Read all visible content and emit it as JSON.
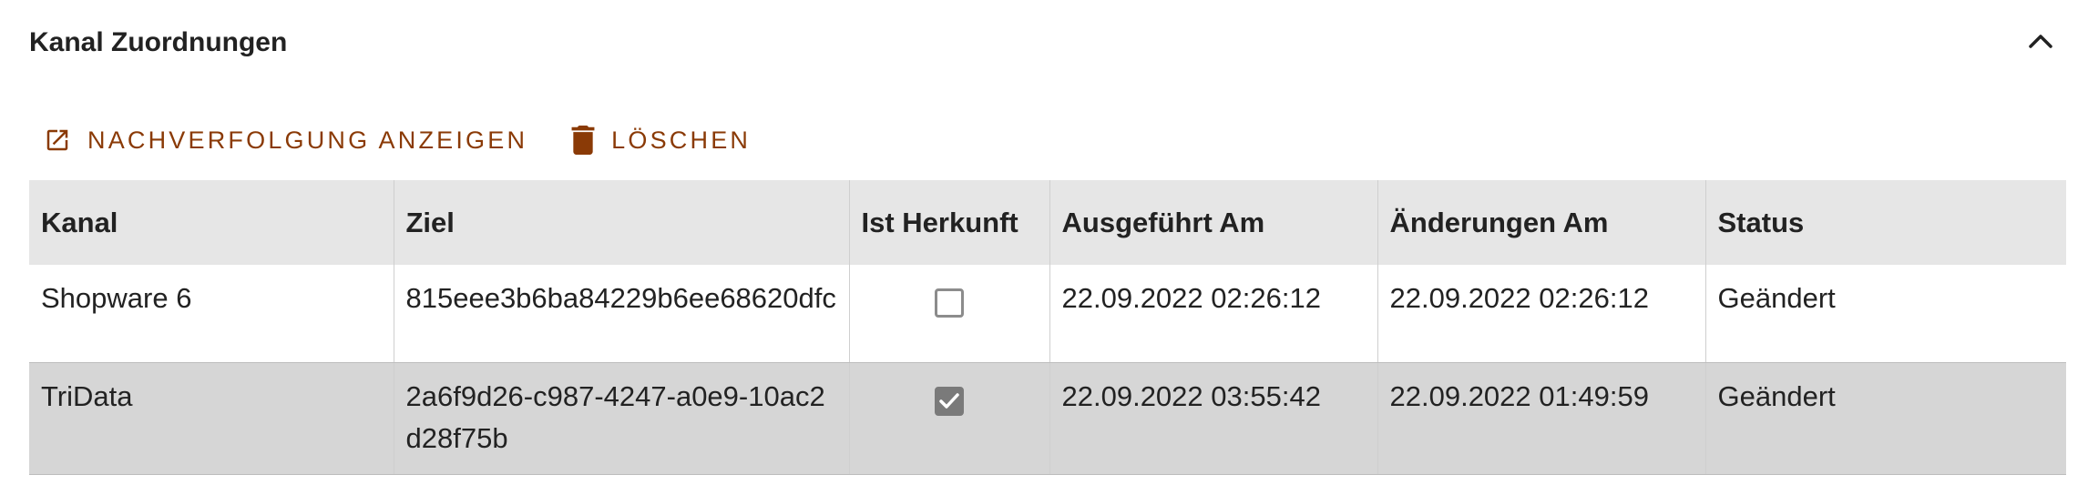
{
  "panel": {
    "title": "Kanal Zuordnungen",
    "collapse_icon": "chevron-up-icon"
  },
  "toolbar": {
    "trace_label": "NACHVERFOLGUNG ANZEIGEN",
    "trace_icon": "open-external-icon",
    "delete_label": "LÖSCHEN",
    "delete_icon": "trash-icon",
    "accent_color": "#8a3a06"
  },
  "table": {
    "columns": [
      "Kanal",
      "Ziel",
      "Ist Herkunft",
      "Ausgeführt Am",
      "Änderungen Am",
      "Status"
    ],
    "rows": [
      {
        "kanal": "Shopware 6",
        "ziel": "815eee3b6ba84229b6ee68620dfc",
        "ist_herkunft": false,
        "ausgefuehrt_am": "22.09.2022 02:26:12",
        "aenderungen_am": "22.09.2022 02:26:12",
        "status": "Geändert"
      },
      {
        "kanal": "TriData",
        "ziel": "2a6f9d26-c987-4247-a0e9-10ac2d28f75b",
        "ist_herkunft": true,
        "ausgefuehrt_am": "22.09.2022 03:55:42",
        "aenderungen_am": "22.09.2022 01:49:59",
        "status": "Geändert"
      }
    ]
  }
}
